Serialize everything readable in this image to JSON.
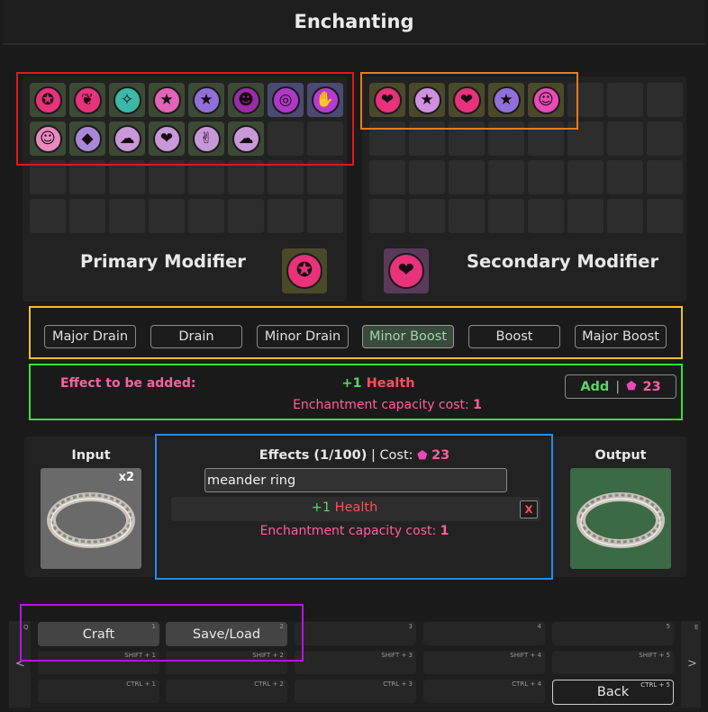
{
  "window": {
    "title": "Enchanting"
  },
  "primary": {
    "label": "Primary Modifier",
    "modifiers": [
      {
        "name": "heart-star-icon",
        "glyph": "✪",
        "bg": "#3c4a35",
        "orb": "#e8327a"
      },
      {
        "name": "hearts-icon",
        "glyph": "❦",
        "bg": "#3c4a35",
        "orb": "#e8327a"
      },
      {
        "name": "sparkle-icon",
        "glyph": "✧",
        "bg": "#3c4a35",
        "orb": "#3ab8a8"
      },
      {
        "name": "pink-star-icon",
        "glyph": "★",
        "bg": "#3c4a35",
        "orb": "#e264b6"
      },
      {
        "name": "purple-star-icon",
        "glyph": "★",
        "bg": "#3c4a35",
        "orb": "#9070d8"
      },
      {
        "name": "head-icon",
        "glyph": "☻",
        "bg": "#3c4a35",
        "orb": "#9a2ca8"
      },
      {
        "name": "ring-icon",
        "glyph": "◎",
        "bg": "#4a4a72",
        "orb": "#b038c8"
      },
      {
        "name": "hand-icon",
        "glyph": "✋",
        "bg": "#4a4a72",
        "orb": "#b83ad0"
      },
      {
        "name": "face-icon",
        "glyph": "☺",
        "bg": "#3c4a35",
        "orb": "#e88ac0"
      },
      {
        "name": "cube-icon",
        "glyph": "◆",
        "bg": "#3c4a35",
        "orb": "#a888d8"
      },
      {
        "name": "cloud-icon",
        "glyph": "☁",
        "bg": "#3c4a35",
        "orb": "#c898d8"
      },
      {
        "name": "lips-icon",
        "glyph": "❤",
        "bg": "#3c4a35",
        "orb": "#c898d8"
      },
      {
        "name": "hand-wave-icon",
        "glyph": "✌",
        "bg": "#3c4a35",
        "orb": "#c898d8"
      },
      {
        "name": "pillow-icon",
        "glyph": "☁",
        "bg": "#3c4a35",
        "orb": "#c898d8"
      }
    ],
    "selected": {
      "name": "selected-primary-modifier-icon",
      "glyph": "✪",
      "bg": "#4a4a2a",
      "orb": "#e8327a"
    }
  },
  "secondary": {
    "label": "Secondary Modifier",
    "modifiers": [
      {
        "name": "heart-icon",
        "glyph": "❤",
        "bg": "#4a4a2a",
        "orb": "#e8327a"
      },
      {
        "name": "star-light-icon",
        "glyph": "★",
        "bg": "#4a4a2a",
        "orb": "#d090e0"
      },
      {
        "name": "heart-pink-icon",
        "glyph": "❤",
        "bg": "#4a4a2a",
        "orb": "#e8327a"
      },
      {
        "name": "star-purple-icon",
        "glyph": "★",
        "bg": "#4a4a2a",
        "orb": "#9070d8"
      },
      {
        "name": "person-icon",
        "glyph": "☺",
        "bg": "#4a4a2a",
        "orb": "#e84ab8"
      }
    ],
    "selected": {
      "name": "selected-secondary-modifier-icon",
      "glyph": "❤",
      "bg": "#5a3a5a",
      "orb": "#e8327a"
    }
  },
  "strengths": [
    "Major Drain",
    "Drain",
    "Minor Drain",
    "Minor Boost",
    "Boost",
    "Major Boost"
  ],
  "selected_strength": "Minor Boost",
  "effect_preview": {
    "label": "Effect to be added:",
    "amount": "+1",
    "stat": "Health",
    "cost_label": "Enchantment capacity cost:",
    "cost_value": "1",
    "add_label": "Add",
    "add_cost": "23"
  },
  "input": {
    "label": "Input",
    "count": "x2",
    "item_icon": "meander-ring-icon"
  },
  "effects": {
    "title": "Effects (1/100)",
    "cost_label": "Cost:",
    "cost_value": "23",
    "name_value": "meander ring",
    "entry_amount": "+1",
    "entry_stat": "Health",
    "remove_label": "X",
    "cost_line_label": "Enchantment capacity cost:",
    "cost_line_value": "1"
  },
  "output": {
    "label": "Output",
    "item_icon": "meander-ring-icon"
  },
  "hotbar": {
    "q_key": "Q",
    "e_key": "E",
    "left_arrow": "<",
    "right_arrow": ">",
    "craft_label": "Craft",
    "craft_key": "1",
    "save_label": "Save/Load",
    "save_key": "2",
    "keys": [
      "3",
      "4",
      "5"
    ],
    "shift_keys": [
      "SHIFT + 1",
      "SHIFT + 2",
      "SHIFT + 3",
      "SHIFT + 4",
      "SHIFT + 5"
    ],
    "ctrl_keys": [
      "CTRL + 1",
      "CTRL + 2",
      "CTRL + 3",
      "CTRL + 4",
      "CTRL + 5"
    ],
    "back_label": "Back"
  },
  "colors": {
    "highlight_red": "#e01818",
    "highlight_orange": "#f07a18",
    "highlight_yellow": "#f0c030",
    "highlight_green": "#38e038",
    "highlight_blue": "#2a8ae8",
    "highlight_purple": "#b018e0",
    "accent_pink": "#ff5fa2",
    "accent_green": "#5ad46a",
    "accent_red": "#ff4e5a",
    "gem": "#e84ab8"
  }
}
